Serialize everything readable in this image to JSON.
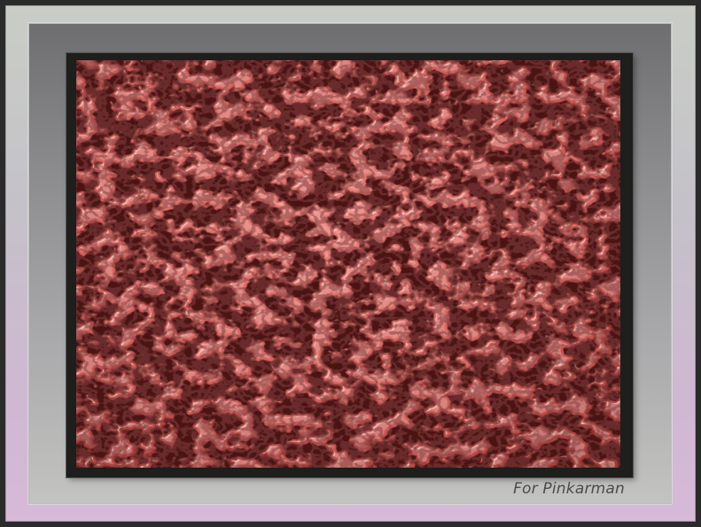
{
  "caption": "For Pinkarman",
  "colors": {
    "outer_mat": "#cfc4d0",
    "inner_mat": "#8f8f91",
    "frame": "#1e1e1c",
    "texture_base": "#c85450",
    "texture_highlight": "#f39a94",
    "texture_shadow": "#3a0c0c"
  }
}
